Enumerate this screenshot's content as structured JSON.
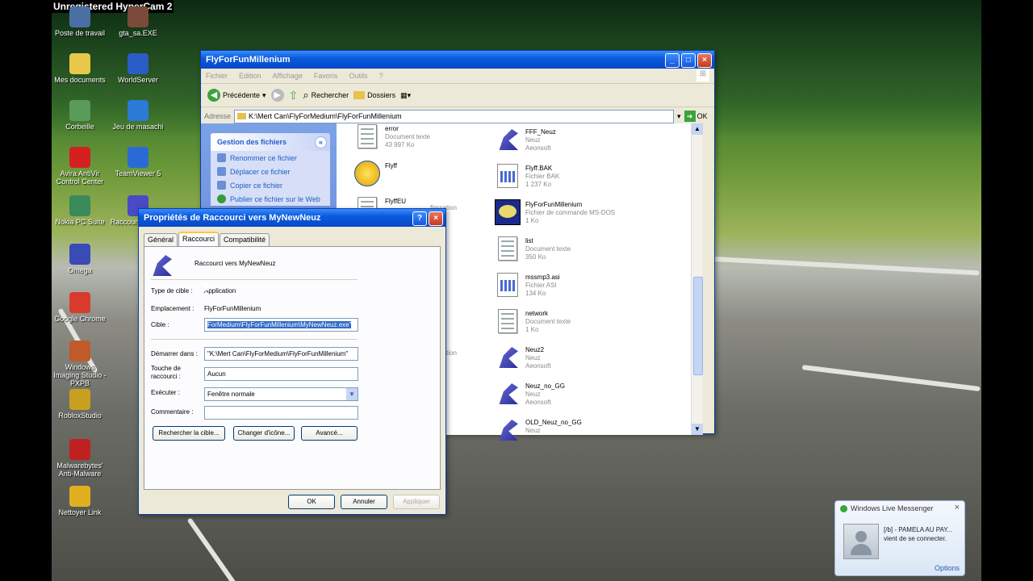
{
  "watermark": "Unregistered HyperCam 2",
  "desktop_icons": [
    {
      "label": "Poste de travail",
      "icon": "my-computer-icon",
      "color": "#4a6fa5"
    },
    {
      "label": "gta_sa.EXE",
      "icon": "gta-icon",
      "color": "#7a4a3a"
    },
    {
      "label": "Mes documents",
      "icon": "my-documents-icon",
      "color": "#e8c84a"
    },
    {
      "label": "WorldServer",
      "icon": "world-server-icon",
      "color": "#2a5cc6"
    },
    {
      "label": "Corbeille",
      "icon": "recycle-bin-icon",
      "color": "#5a9a5a"
    },
    {
      "label": "Jeu de masachi",
      "icon": "game-icon",
      "color": "#2a7ad6"
    },
    {
      "label": "Avira AntiVir Control Center",
      "icon": "avira-icon",
      "color": "#d42020"
    },
    {
      "label": "TeamViewer 5",
      "icon": "teamviewer-icon",
      "color": "#2a6ad6"
    },
    {
      "label": "Nokia PC Suite",
      "icon": "nokia-icon",
      "color": "#3a8a5a"
    },
    {
      "label": "Raccourci MyN...",
      "icon": "shortcut-icon",
      "color": "#4a4ac6"
    },
    {
      "label": "Omega",
      "icon": "omega-icon",
      "color": "#3a4ab6"
    },
    {
      "label": "Google Chrome",
      "icon": "chrome-icon",
      "color": "#d83b2b"
    },
    {
      "label": "Windows Imaging Studio - PXPB",
      "icon": "imaging-icon",
      "color": "#c05a2a"
    },
    {
      "label": "RobloxStudio",
      "icon": "roblox-icon",
      "color": "#c8a020"
    },
    {
      "label": "Malwarebytes' Anti-Malware",
      "icon": "malwarebytes-icon",
      "color": "#c02020"
    },
    {
      "label": "Nettoyer Link",
      "icon": "link-icon",
      "color": "#e0b020"
    }
  ],
  "explorer": {
    "title": "FlyForFunMillenium",
    "menu": [
      "Fichier",
      "Edition",
      "Affichage",
      "Favoris",
      "Outils",
      "?"
    ],
    "toolbar": {
      "back": "Précédente",
      "search": "Rechercher",
      "folders": "Dossiers"
    },
    "address_label": "Adresse",
    "address": "K:\\Mert Can\\FlyForMedium\\FlyForFunMillenium",
    "go": "OK",
    "task_panel": {
      "title": "Gestion des fichiers",
      "items": [
        "Renommer ce fichier",
        "Déplacer ce fichier",
        "Copier ce fichier",
        "Publier ce fichier sur le Web"
      ]
    },
    "files_left": [
      {
        "name": "error",
        "type": "Document texte",
        "size": "43 997 Ko",
        "icon": "text-document-icon"
      },
      {
        "name": "Flyff",
        "type": "",
        "size": "",
        "icon": "flyff-icon"
      },
      {
        "name": "FlyffEU",
        "type": "",
        "size": "",
        "icon": "config-icon"
      }
    ],
    "partial_labels": [
      "figuration",
      "figuration"
    ],
    "files_right": [
      {
        "name": "FFF_Neuz",
        "type": "Neuz",
        "size": "Aeonsoft",
        "icon": "neuz-icon"
      },
      {
        "name": "Flyff.BAK",
        "type": "Fichier BAK",
        "size": "1 237 Ko",
        "icon": "bak-file-icon"
      },
      {
        "name": "FlyForFunMillenium",
        "type": "Fichier de commande MS-DOS",
        "size": "1 Ko",
        "icon": "msdos-batch-icon"
      },
      {
        "name": "list",
        "type": "Document texte",
        "size": "350 Ko",
        "icon": "text-document-icon"
      },
      {
        "name": "mssmp3.asi",
        "type": "Fichier ASI",
        "size": "134 Ko",
        "icon": "asi-file-icon"
      },
      {
        "name": "network",
        "type": "Document texte",
        "size": "1 Ko",
        "icon": "text-document-icon"
      },
      {
        "name": "Neuz2",
        "type": "Neuz",
        "size": "Aeonsoft",
        "icon": "neuz-icon"
      },
      {
        "name": "Neuz_no_GG",
        "type": "Neuz",
        "size": "Aeonsoft",
        "icon": "neuz-icon"
      },
      {
        "name": "OLD_Neuz_no_GG",
        "type": "Neuz",
        "size": "",
        "icon": "neuz-icon"
      }
    ]
  },
  "dialog": {
    "title": "Propriétés de Raccourci vers MyNewNeuz",
    "tabs": [
      "Général",
      "Raccourci",
      "Compatibilité"
    ],
    "active_tab": "Raccourci",
    "shortcut_name": "Raccourci vers MyNewNeuz",
    "fields": {
      "target_type_label": "Type de cible :",
      "target_type": "Application",
      "location_label": "Emplacement :",
      "location": "FlyForFunMillenium",
      "target_label": "Cible :",
      "target": "ForMedium\\FlyForFunMillenium\\MyNewNeuz.exe\"",
      "start_in_label": "Démarrer dans :",
      "start_in": "\"K:\\Mert Can\\FlyForMedium\\FlyForFunMillenium\"",
      "shortcut_key_label": "Touche de raccourci :",
      "shortcut_key": "Aucun",
      "run_label": "Exécuter :",
      "run": "Fenêtre normale",
      "comment_label": "Commentaire :",
      "comment": ""
    },
    "buttons": {
      "find_target": "Rechercher la cible...",
      "change_icon": "Changer d'icône...",
      "advanced": "Avancé...",
      "ok": "OK",
      "cancel": "Annuler",
      "apply": "Appliquer"
    }
  },
  "messenger": {
    "title": "Windows Live Messenger",
    "message_line1": "[/b] - PAMELA AU PAY...",
    "message_line2": "vient de se connecter.",
    "options": "Options"
  }
}
